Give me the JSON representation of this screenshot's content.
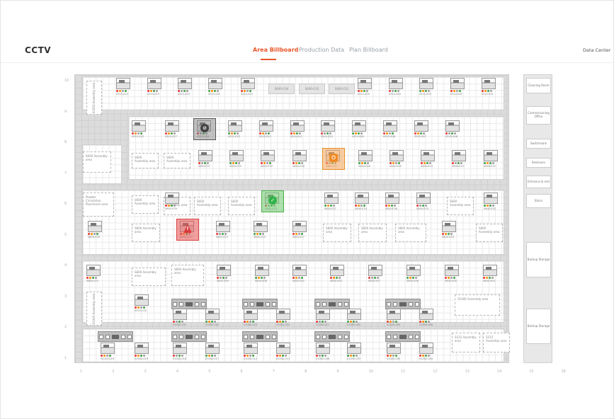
{
  "header": {
    "logo": "CCTV",
    "tabs": [
      "Area Billboard",
      "Production Data",
      "Plan Billboard"
    ],
    "active_tab": "Area Billboard",
    "data_center": "Data Center"
  },
  "axis": {
    "rows": [
      "10",
      "9",
      "8",
      "7",
      "6",
      "5",
      "4",
      "3",
      "2",
      "1"
    ],
    "cols": [
      "1",
      "2",
      "3",
      "4",
      "5",
      "6",
      "7",
      "8",
      "9",
      "10",
      "11",
      "12",
      "13",
      "14",
      "15",
      "16"
    ]
  },
  "rooms": [
    "Cleaning Room",
    "Commissioning Office",
    "Switchroom",
    "Restroom",
    "Entrance & exit",
    "Stairs",
    "Backup Storage",
    "Backup Storage"
  ],
  "zones": {
    "z1": "S1000 Assembly area",
    "z2": "S600 Assembly area",
    "z3": "Powder Circulation Placement area",
    "z4": "S1000 Assembly area",
    "z5": "S1000 Assembly area",
    "z6": "S515 Assembly area",
    "z7": "S515 Assembly area"
  },
  "row10": [
    "S515-023",
    "S515-023",
    "S515-023",
    "S515-023",
    "S515-023",
    "S515-005",
    "S515-004",
    "S515-003",
    "S515-002",
    "S515-001"
  ],
  "dark_cells": [
    "S600-C04",
    "S600-C02",
    "S600-C01"
  ],
  "row8": [
    "S515-023",
    "S515-017",
    "S515-016",
    "S515-013",
    "S515-012",
    "S515-011",
    "S515-010",
    "S515-009",
    "S515-008",
    "S515-007",
    "S515-006"
  ],
  "row7_areas": [
    "S600 Assembly area",
    "S600 Assembly area"
  ],
  "row7": [
    "S600-E37",
    "S600-E35",
    "S600-E33",
    "S600-E28",
    "S600-E27",
    "S600-E26",
    "S600-E25",
    "S600-E24",
    "S600-E23",
    "S600-E22"
  ],
  "row6_areas": [
    "S600 Assembly area",
    "S600 Assembly area",
    "S600 Assembly area",
    "S600 Assembly area"
  ],
  "row6": [
    "S600-E39",
    "S600-E12",
    "S600-E37",
    "S600-E34",
    "S600-E36",
    "S600-E19",
    "S600-E32"
  ],
  "row5_areas": [
    "S800 Assembly area",
    "S800 Assembly area",
    "S800 Assembly area",
    "S800 Assembly area",
    "S800 Assembly area"
  ],
  "row5": [
    "S800-016",
    "S800-012",
    "S800-013",
    "S800-014",
    "S800-017",
    "S800-018"
  ],
  "row4_areas": [
    "S800 Assembly area",
    "S800 Assembly area"
  ],
  "row4": [
    "S800-015",
    "S800-009",
    "S800-008",
    "S800-052",
    "S800-003",
    "S800-007",
    "S800-006",
    "S800-005",
    "S800-004"
  ],
  "row3": [
    "S515-016",
    "S1000-021",
    "S1000-020",
    "S1000-015",
    "S1000-014",
    "S1000-011",
    "S1000-010",
    "S1000-009",
    "S1000-008"
  ],
  "row1": [
    "S1000-018",
    "S1000-019",
    "S1000-018",
    "S1000-017",
    "S1000-012",
    "S1000-013",
    "S1000-006",
    "S1000-007",
    "S1000-005",
    "S1000-004"
  ],
  "status_colors": {
    "red": "#e53935",
    "orange": "#fb8c00",
    "green": "#43a047",
    "gray": "#9e9e9e"
  }
}
